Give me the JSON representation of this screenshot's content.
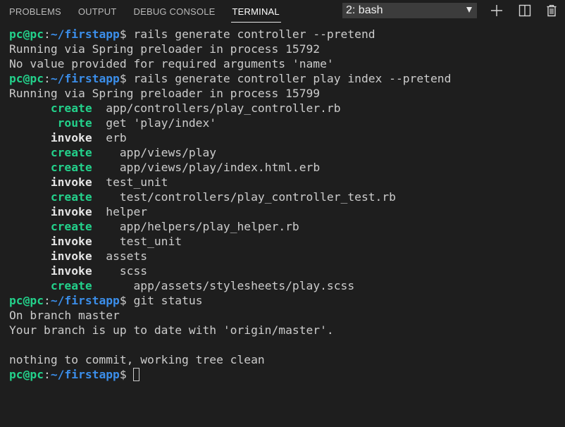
{
  "panel": {
    "tabs": [
      {
        "label": "PROBLEMS",
        "active": false
      },
      {
        "label": "OUTPUT",
        "active": false
      },
      {
        "label": "DEBUG CONSOLE",
        "active": false
      },
      {
        "label": "TERMINAL",
        "active": true
      }
    ],
    "terminal_select": {
      "value": "2: bash",
      "icon": "chevron-down-icon"
    },
    "actions": [
      {
        "name": "new-terminal",
        "icon": "plus-icon"
      },
      {
        "name": "split-terminal",
        "icon": "split-icon"
      },
      {
        "name": "kill-terminal",
        "icon": "trash-icon"
      }
    ],
    "colors": {
      "background": "#1e1e1e",
      "prompt_user": "#23d18b",
      "prompt_path": "#3b8eea",
      "text": "#cccccc"
    }
  },
  "prompt": {
    "user": "pc@pc",
    "sep": ":",
    "path": "~/firstapp",
    "sym": "$ "
  },
  "terminal": {
    "lines": [
      {
        "prompt": true,
        "cmd": "rails generate controller --pretend"
      },
      {
        "text": "Running via Spring preloader in process 15792"
      },
      {
        "text": "No value provided for required arguments 'name'"
      },
      {
        "prompt": true,
        "cmd": "rails generate controller play index --pretend"
      },
      {
        "text": "Running via Spring preloader in process 15799"
      },
      {
        "lead": "      ",
        "tag": "create",
        "color": "green",
        "rest": "  app/controllers/play_controller.rb"
      },
      {
        "lead": "       ",
        "tag": "route",
        "color": "green",
        "rest": "  get 'play/index'"
      },
      {
        "lead": "      ",
        "tag": "invoke",
        "color": "white",
        "rest": "  erb"
      },
      {
        "lead": "      ",
        "tag": "create",
        "color": "green",
        "rest": "    app/views/play"
      },
      {
        "lead": "      ",
        "tag": "create",
        "color": "green",
        "rest": "    app/views/play/index.html.erb"
      },
      {
        "lead": "      ",
        "tag": "invoke",
        "color": "white",
        "rest": "  test_unit"
      },
      {
        "lead": "      ",
        "tag": "create",
        "color": "green",
        "rest": "    test/controllers/play_controller_test.rb"
      },
      {
        "lead": "      ",
        "tag": "invoke",
        "color": "white",
        "rest": "  helper"
      },
      {
        "lead": "      ",
        "tag": "create",
        "color": "green",
        "rest": "    app/helpers/play_helper.rb"
      },
      {
        "lead": "      ",
        "tag": "invoke",
        "color": "white",
        "rest": "    test_unit"
      },
      {
        "lead": "      ",
        "tag": "invoke",
        "color": "white",
        "rest": "  assets"
      },
      {
        "lead": "      ",
        "tag": "invoke",
        "color": "white",
        "rest": "    scss"
      },
      {
        "lead": "      ",
        "tag": "create",
        "color": "green",
        "rest": "      app/assets/stylesheets/play.scss"
      },
      {
        "prompt": true,
        "cmd": "git status"
      },
      {
        "text": "On branch master"
      },
      {
        "text": "Your branch is up to date with 'origin/master'."
      },
      {
        "text": ""
      },
      {
        "text": "nothing to commit, working tree clean"
      },
      {
        "prompt": true,
        "cmd": "",
        "cursor": true
      }
    ]
  }
}
